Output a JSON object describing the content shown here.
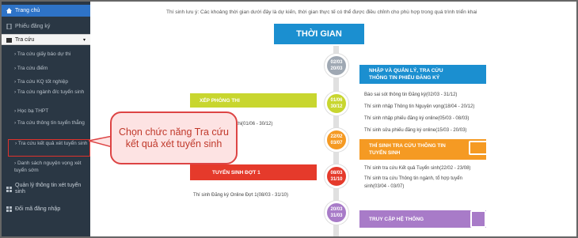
{
  "sidebar": {
    "home": "Trang chủ",
    "register": "Phiếu đăng ký",
    "lookup": "Tra cứu",
    "sub_items": [
      "Tra cứu giấy báo dự thi",
      "Tra cứu điểm",
      "Tra cứu KQ tốt nghiệp",
      "Tra cứu ngành đ/c tuyển sinh",
      "Học bạ THPT",
      "Tra cứu thông tin tuyển thẳng",
      "Tra cứu kết quả xét tuyển sinh",
      "Danh sách nguyện vọng xét tuyển sớm"
    ],
    "manage": "Quản lý thông tin xét tuyển sinh",
    "logout": "Đổi mã đăng nhập"
  },
  "main": {
    "notice": "Thí sinh lưu ý: Các khoảng thời gian dưới đây là dự kiến, thời gian thực tế có thể được điều chỉnh cho phù hợp trong quá trình triển khai",
    "ribbon": "THỜI GIAN",
    "nodes": [
      {
        "d1": "02/03",
        "d2": "20/03",
        "color": "#9fa8b3"
      },
      {
        "d1": "01/06",
        "d2": "30/12",
        "color": "#c8d62f"
      },
      {
        "d1": "22/02",
        "d2": "03/07",
        "color": "#f59a23"
      },
      {
        "d1": "08/03",
        "d2": "31/10",
        "color": "#e53a2b"
      },
      {
        "d1": "20/03",
        "d2": "31/03",
        "color": "#a87bc8"
      }
    ],
    "b1": {
      "title1": "NHẬP VÀ QUẢN LÝ, TRA CỨU",
      "title2": "THÔNG TIN PHIẾU ĐĂNG KÝ",
      "items": [
        "Báo sai sót thông tin Đăng ký(02/03 - 31/12)",
        "Thí sinh nhập Thông tin Nguyện vọng(18/04 - 20/12)",
        "Thí sinh nhập phiếu đăng ký online(05/03 - 08/03)",
        "Thí sinh sửa phiếu đăng ký online(15/03 - 20/03)"
      ]
    },
    "b2": {
      "title": "XẾP PHÒNG THI",
      "item": "Giấy báo dự thi(01/06 - 30/12)"
    },
    "b3": {
      "title1": "THÍ SINH TRA CỨU THÔNG TIN",
      "title2": "TUYỂN SINH",
      "items": [
        "Thí sinh tra cứu Kết quả Tuyển sinh(22/02 - 23/08)",
        "Thí sinh tra cứu Thông tin ngành, tổ hợp tuyển",
        "sinh(03/04 - 03/07)"
      ]
    },
    "b4": {
      "title": "TUYỂN SINH ĐỢT 1",
      "item": "Thí sinh Đăng ký Online Đợt 1(08/03 - 31/10)"
    },
    "b5": {
      "title": "TRUY CẬP HỆ THỐNG"
    }
  },
  "callout": {
    "text": "Chọn chức năng Tra cứu kết quả xét tuyển sinh"
  }
}
